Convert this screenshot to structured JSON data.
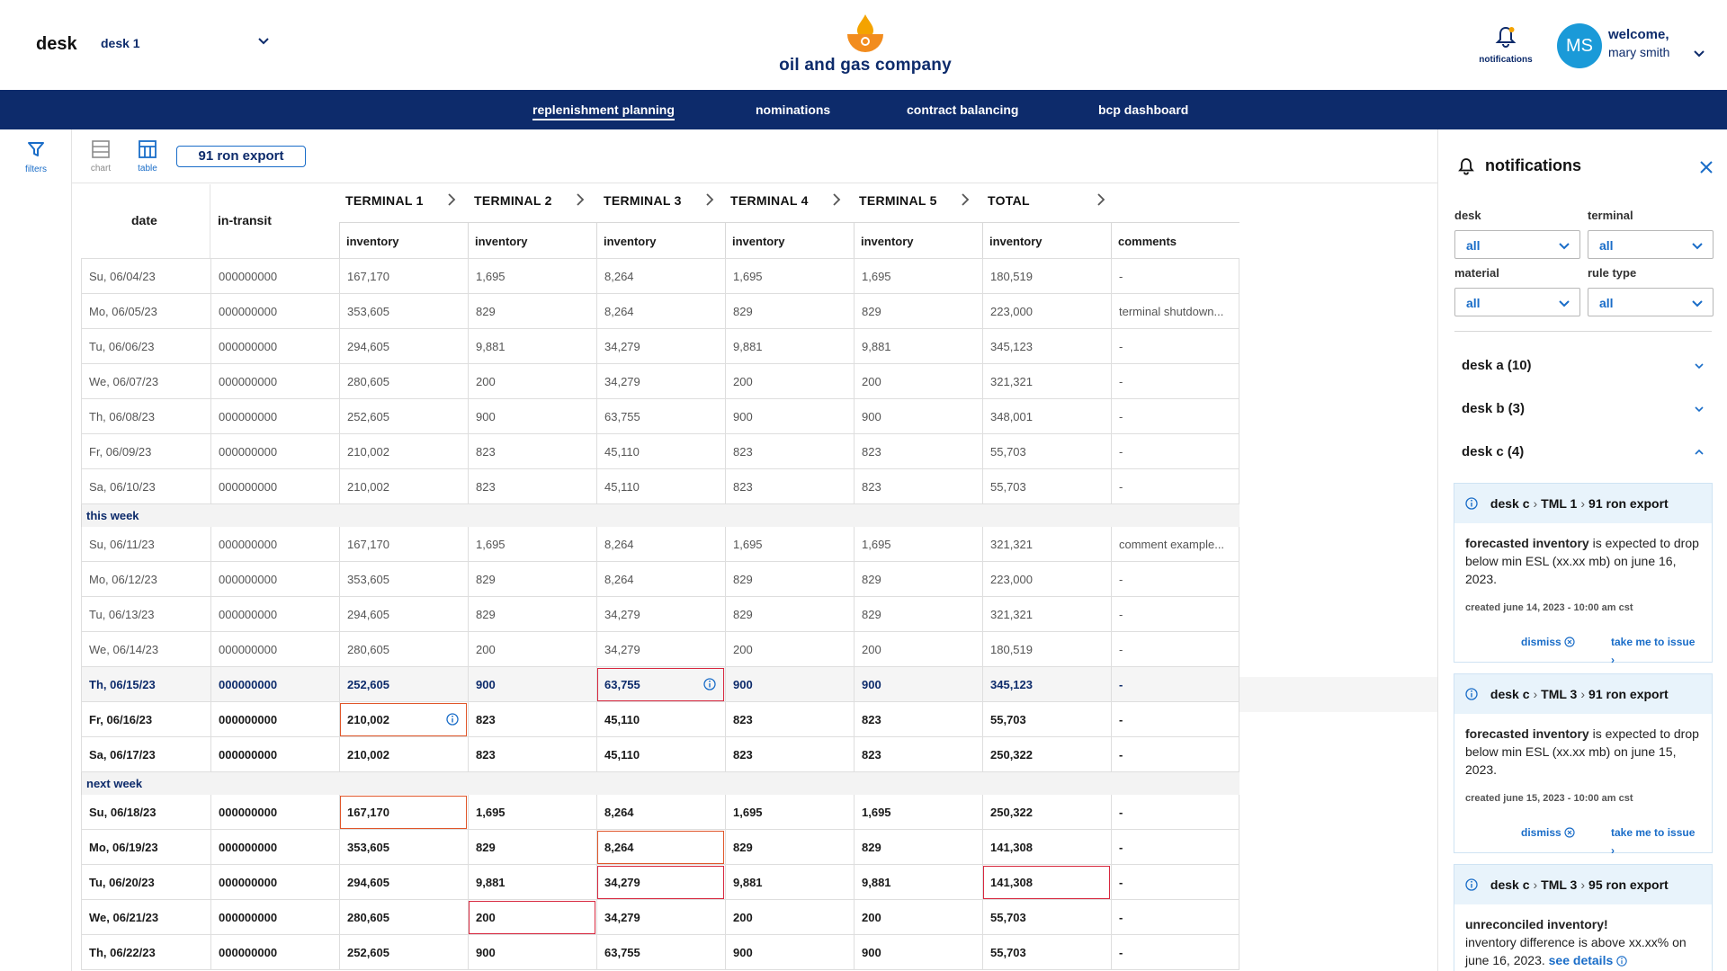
{
  "header": {
    "desk_label": "desk",
    "desk_value": "desk 1",
    "company_name": "oil and gas company",
    "notifications_label": "notifications",
    "user_initials": "MS",
    "welcome": "welcome,",
    "user_name": "mary smith"
  },
  "nav": {
    "items": [
      "replenishment planning",
      "nominations",
      "contract balancing",
      "bcp dashboard"
    ],
    "active": "replenishment planning"
  },
  "rail": {
    "filters_label": "filters"
  },
  "toolbar": {
    "chart_label": "chart",
    "table_label": "table",
    "product": "91 ron export"
  },
  "table": {
    "col_date": "date",
    "col_transit": "in-transit",
    "terminals": [
      "TERMINAL 1",
      "TERMINAL 2",
      "TERMINAL 3",
      "TERMINAL 4",
      "TERMINAL 5",
      "TOTAL"
    ],
    "sub_inventory": "inventory",
    "col_comments": "comments",
    "groups": [
      {
        "label": "",
        "rows": [
          [
            "Su, 06/04/23",
            "000000000",
            "167,170",
            "1,695",
            "8,264",
            "1,695",
            "1,695",
            "180,519",
            "-"
          ],
          [
            "Mo, 06/05/23",
            "000000000",
            "353,605",
            "829",
            "8,264",
            "829",
            "829",
            "223,000",
            "terminal shutdown..."
          ],
          [
            "Tu, 06/06/23",
            "000000000",
            "294,605",
            "9,881",
            "34,279",
            "9,881",
            "9,881",
            "345,123",
            "-"
          ],
          [
            "We, 06/07/23",
            "000000000",
            "280,605",
            "200",
            "34,279",
            "200",
            "200",
            "321,321",
            "-"
          ],
          [
            "Th, 06/08/23",
            "000000000",
            "252,605",
            "900",
            "63,755",
            "900",
            "900",
            "348,001",
            "-"
          ],
          [
            "Fr, 06/09/23",
            "000000000",
            "210,002",
            "823",
            "45,110",
            "823",
            "823",
            "55,703",
            "-"
          ],
          [
            "Sa, 06/10/23",
            "000000000",
            "210,002",
            "823",
            "45,110",
            "823",
            "823",
            "55,703",
            "-"
          ]
        ]
      },
      {
        "label": "this week",
        "rows": [
          [
            "Su, 06/11/23",
            "000000000",
            "167,170",
            "1,695",
            "8,264",
            "1,695",
            "1,695",
            "321,321",
            "comment example..."
          ],
          [
            "Mo, 06/12/23",
            "000000000",
            "353,605",
            "829",
            "8,264",
            "829",
            "829",
            "223,000",
            "-"
          ],
          [
            "Tu, 06/13/23",
            "000000000",
            "294,605",
            "829",
            "34,279",
            "829",
            "829",
            "321,321",
            "-"
          ],
          [
            "We, 06/14/23",
            "000000000",
            "280,605",
            "200",
            "34,279",
            "200",
            "200",
            "180,519",
            "-"
          ],
          [
            "Th, 06/15/23",
            "000000000",
            "252,605",
            "900",
            "63,755",
            "900",
            "900",
            "345,123",
            "-"
          ],
          [
            "Fr, 06/16/23",
            "000000000",
            "210,002",
            "823",
            "45,110",
            "823",
            "823",
            "55,703",
            "-"
          ],
          [
            "Sa, 06/17/23",
            "000000000",
            "210,002",
            "823",
            "45,110",
            "823",
            "823",
            "250,322",
            "-"
          ]
        ]
      },
      {
        "label": "next week",
        "rows": [
          [
            "Su, 06/18/23",
            "000000000",
            "167,170",
            "1,695",
            "8,264",
            "1,695",
            "1,695",
            "250,322",
            "-"
          ],
          [
            "Mo, 06/19/23",
            "000000000",
            "353,605",
            "829",
            "8,264",
            "829",
            "829",
            "141,308",
            "-"
          ],
          [
            "Tu, 06/20/23",
            "000000000",
            "294,605",
            "9,881",
            "34,279",
            "9,881",
            "9,881",
            "141,308",
            "-"
          ],
          [
            "We, 06/21/23",
            "000000000",
            "280,605",
            "200",
            "34,279",
            "200",
            "200",
            "55,703",
            "-"
          ],
          [
            "Th, 06/22/23",
            "000000000",
            "252,605",
            "900",
            "63,755",
            "900",
            "900",
            "55,703",
            "-"
          ]
        ]
      }
    ]
  },
  "panel": {
    "title": "notifications",
    "filter_labels": {
      "desk": "desk",
      "terminal": "terminal",
      "material": "material",
      "rule_type": "rule type"
    },
    "filter_values": {
      "desk": "all",
      "terminal": "all",
      "material": "all",
      "rule_type": "all"
    },
    "accordions": [
      "desk a (10)",
      "desk b (3)",
      "desk c (4)"
    ],
    "cards": [
      {
        "path": [
          "desk c",
          "TML 1",
          "91 ron export"
        ],
        "lead": "forecasted inventory",
        "text": " is expected to drop below min ESL (xx.xx mb) on june 16, 2023.",
        "meta": "created june 14, 2023 - 10:00 am cst",
        "dismiss": "dismiss",
        "take": "take me to issue"
      },
      {
        "path": [
          "desk c",
          "TML 3",
          "91 ron export"
        ],
        "lead": "forecasted inventory",
        "text": " is expected to drop below min ESL (xx.xx mb) on june 15, 2023.",
        "meta": "created june 15, 2023 - 10:00 am cst",
        "dismiss": "dismiss",
        "take": "take me to issue"
      },
      {
        "path": [
          "desk c",
          "TML 3",
          "95 ron export"
        ],
        "lead": "unreconciled inventory!",
        "text": "inventory difference is above xx.xx% on june 16, 2023.",
        "link": "see details"
      }
    ]
  },
  "colors": {
    "brand_navy": "#0d2b6b",
    "link_blue": "#1a6dc8",
    "avatar_blue": "#1a9ad8",
    "alert_amber": "#e0562a",
    "alert_red": "#d8283f"
  }
}
